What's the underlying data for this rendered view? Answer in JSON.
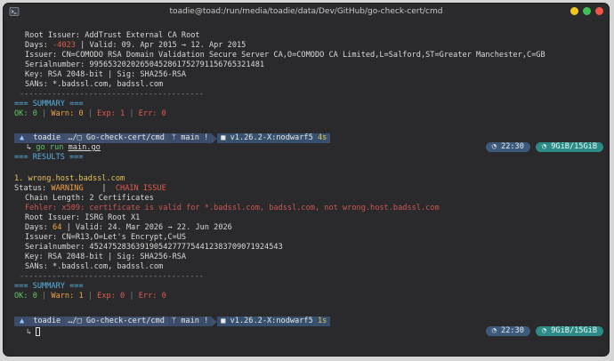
{
  "window": {
    "title": "toadie@toad:/run/media/toadie/data/Dev/GitHub/go-check-cert/cmd"
  },
  "block1": {
    "root_issuer": "Root Issuer: AddTrust External CA Root",
    "days_label": "Days: ",
    "days_value": "-4023",
    "days_rest": " | Valid: 09. Apr 2015 → 12. Apr 2015",
    "issuer": "Issuer: CN=COMODO RSA Domain Validation Secure Server CA,O=COMODO CA Limited,L=Salford,ST=Greater Manchester,C=GB",
    "serial": "Serialnumber: 99565320202650452861752791156765321481",
    "key": "Key: RSA 2048-bit | Sig: SHA256-RSA",
    "sans": "SANs: *.badssl.com, badssl.com",
    "divider": "----------------------------------------",
    "summary_title": "=== SUMMARY ===",
    "summary_ok": "OK: 0",
    "summary_warn": "Warn: 0",
    "summary_exp": "Exp: 1",
    "summary_err": "Err: 0"
  },
  "prompt1": {
    "os": "▲",
    "user": "toadie",
    "path": "…/□ Go-check-cert/cmd",
    "git": "ᛘ main !",
    "go": "■ v1.26.2-X:nodwarf5",
    "duration": "4s",
    "clock": "◔ 22:30",
    "mem": "◔ 9GiB/15GiB",
    "command_arrow": "↳",
    "command_verb": "go run",
    "command_arg": "main.go"
  },
  "results": {
    "title": "=== RESULTS ===",
    "host": "1. wrong.host.badssl.com",
    "status_label": "Status: ",
    "status_value": "WARNING",
    "status_sep": "    |  ",
    "status_issue": "CHAIN ISSUE",
    "chain_length": "Chain Length: 2 Certificates",
    "error": "Fehler: x509: certificate is valid for *.badssl.com, badssl.com, not wrong.host.badssl.com",
    "root_issuer": "Root Issuer: ISRG Root X1",
    "days_label": "Days: ",
    "days_value": "64",
    "days_rest": " | Valid: 24. Mar 2026 → 22. Jun 2026",
    "issuer": "Issuer: CN=R13,O=Let's Encrypt,C=US",
    "serial": "Serialnumber: 452475283639190542777754412383709071924543",
    "key": "Key: RSA 2048-bit | Sig: SHA256-RSA",
    "sans": "SANs: *.badssl.com, badssl.com",
    "divider": "----------------------------------------",
    "summary_title": "=== SUMMARY ===",
    "summary_ok": "OK: 0",
    "summary_warn": "Warn: 1",
    "summary_exp": "Exp: 0",
    "summary_err": "Err: 0"
  },
  "prompt2": {
    "os": "▲",
    "user": "toadie",
    "path": "…/□ Go-check-cert/cmd",
    "git": "ᛘ main !",
    "go": "■ v1.26.2-X:nodwarf5",
    "duration": "1s",
    "clock": "◔ 22:30",
    "mem": "◔ 9GiB/15GiB",
    "command_arrow": "↳"
  },
  "colors": {
    "background": "#2a2a2d",
    "prompt_bar": "#40516f",
    "mem_pill": "#2c8b86",
    "warning": "#f0a241",
    "error": "#e05a4c",
    "ok": "#62c466",
    "host": "#e5c454",
    "summary": "#5ab2e0"
  }
}
